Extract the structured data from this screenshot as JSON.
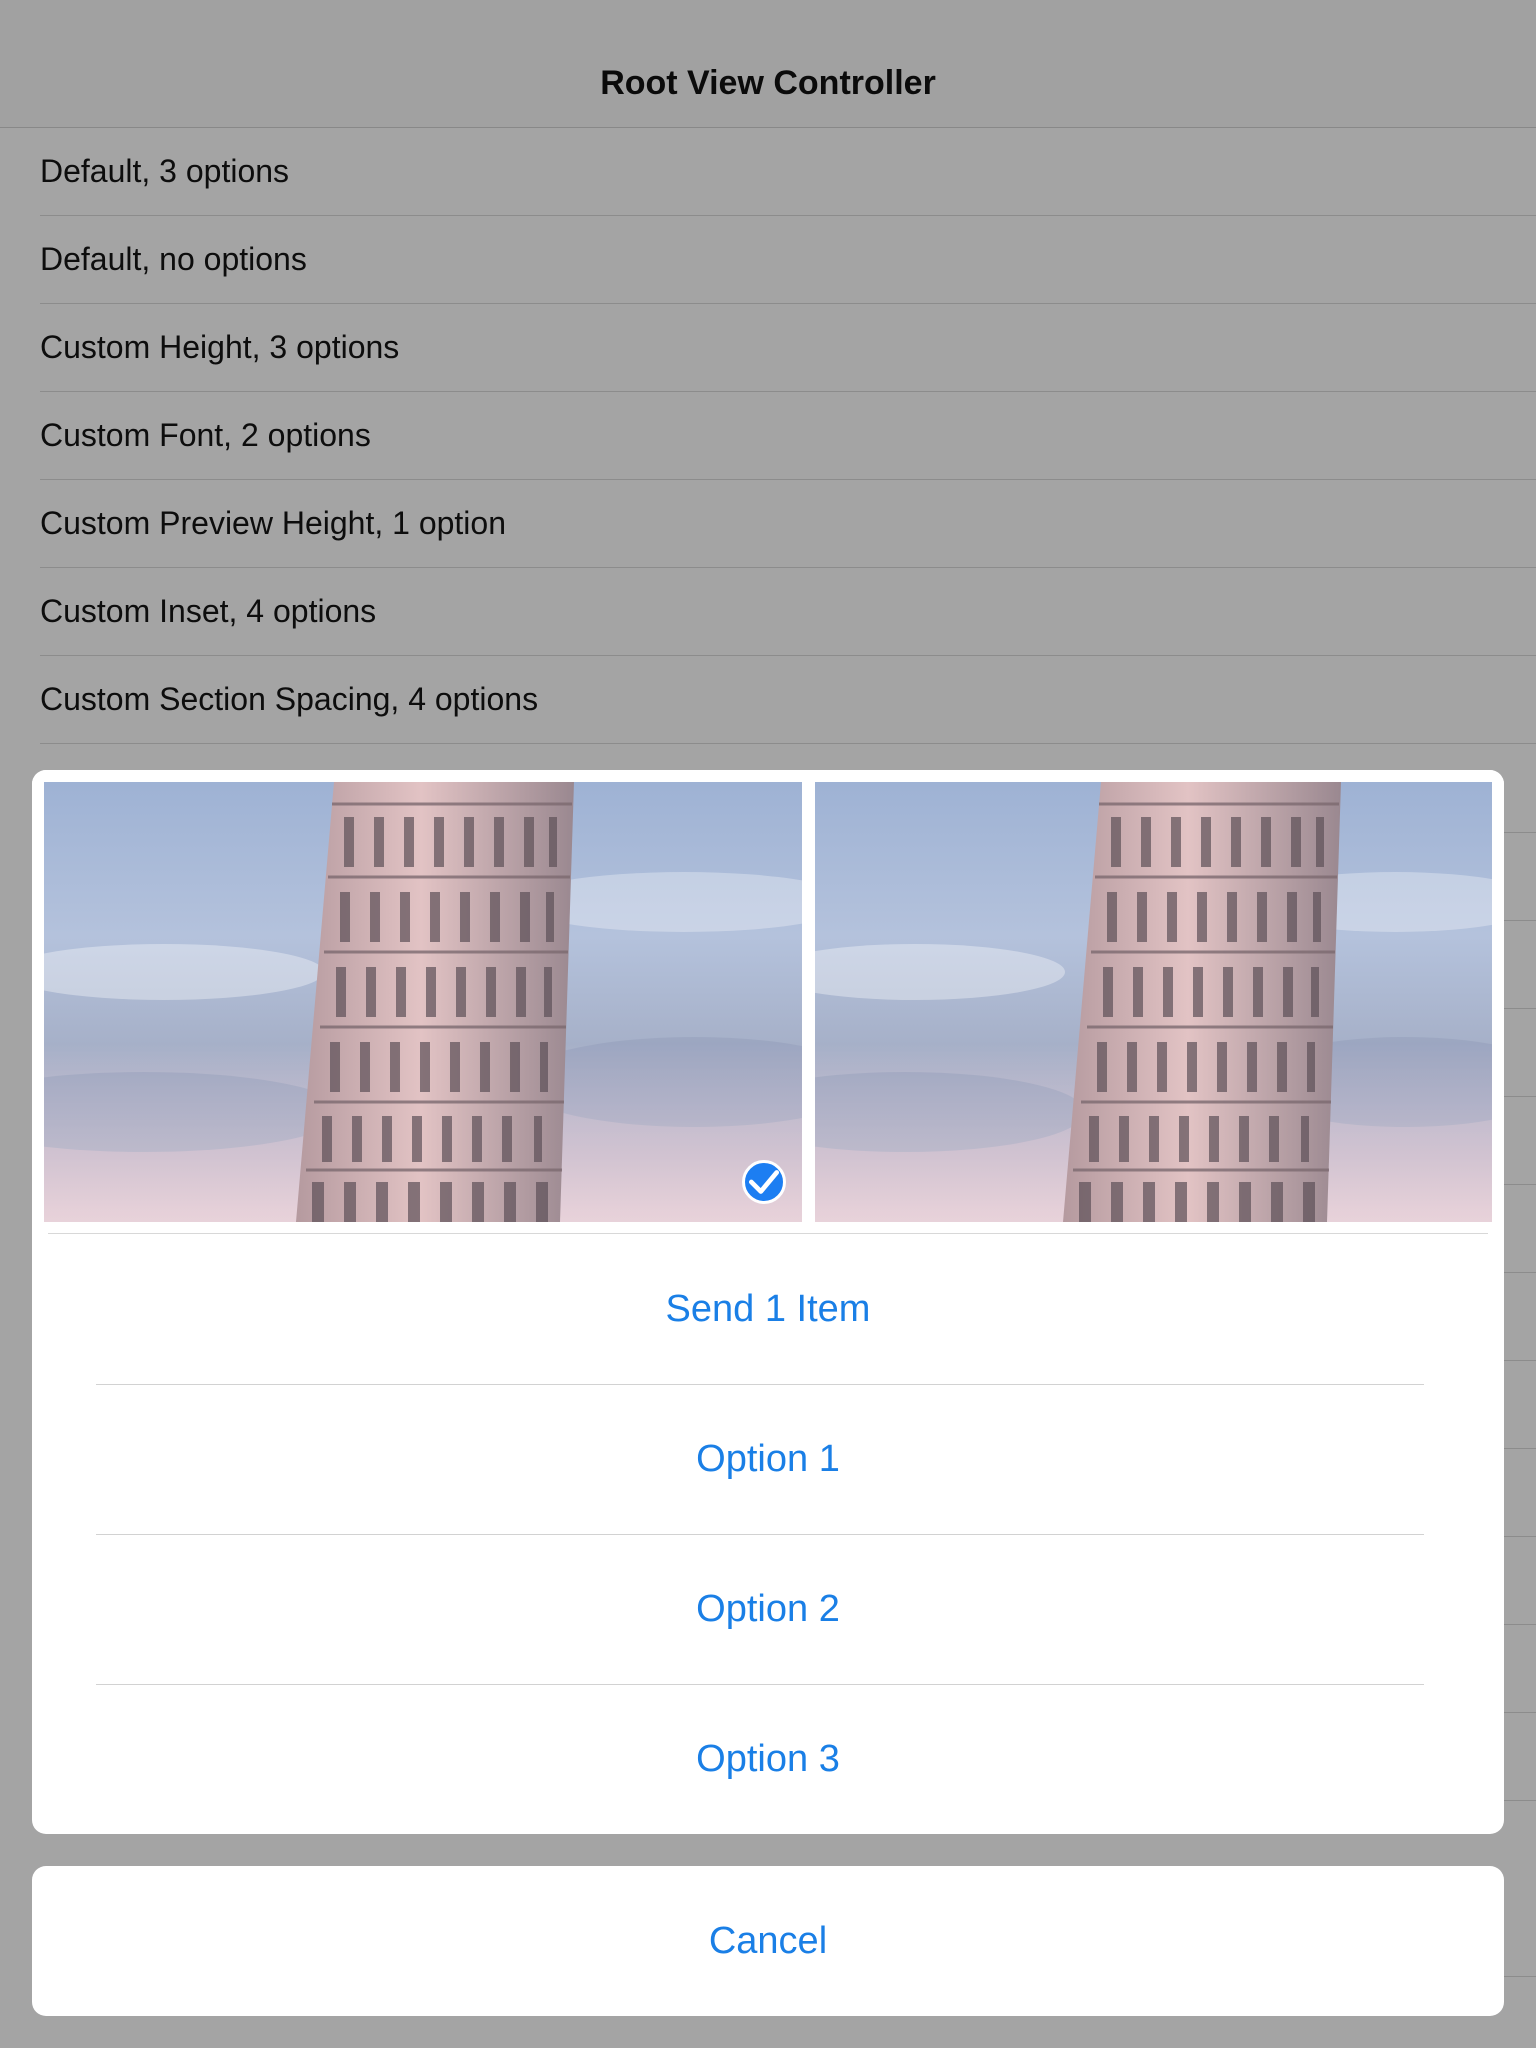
{
  "nav": {
    "title": "Root View Controller"
  },
  "table": {
    "rows": [
      {
        "label": "Default, 3 options"
      },
      {
        "label": "Default, no options"
      },
      {
        "label": "Custom Height, 3 options"
      },
      {
        "label": "Custom Font, 2 options"
      },
      {
        "label": "Custom Preview Height, 1 option"
      },
      {
        "label": "Custom Inset, 4 options"
      },
      {
        "label": "Custom Section Spacing, 4 options"
      }
    ]
  },
  "sheet": {
    "preview": {
      "photos": [
        {
          "icon": "leaning-tower-photo",
          "selected": true
        },
        {
          "icon": "leaning-tower-photo",
          "selected": false
        }
      ]
    },
    "actions": [
      {
        "label": "Send 1 Item"
      },
      {
        "label": "Option 1"
      },
      {
        "label": "Option 2"
      },
      {
        "label": "Option 3"
      }
    ],
    "cancel_label": "Cancel"
  },
  "colors": {
    "accent": "#1a7fe6",
    "dim_background": "#a4a4a4",
    "checkmark": "#1c7ef2"
  }
}
